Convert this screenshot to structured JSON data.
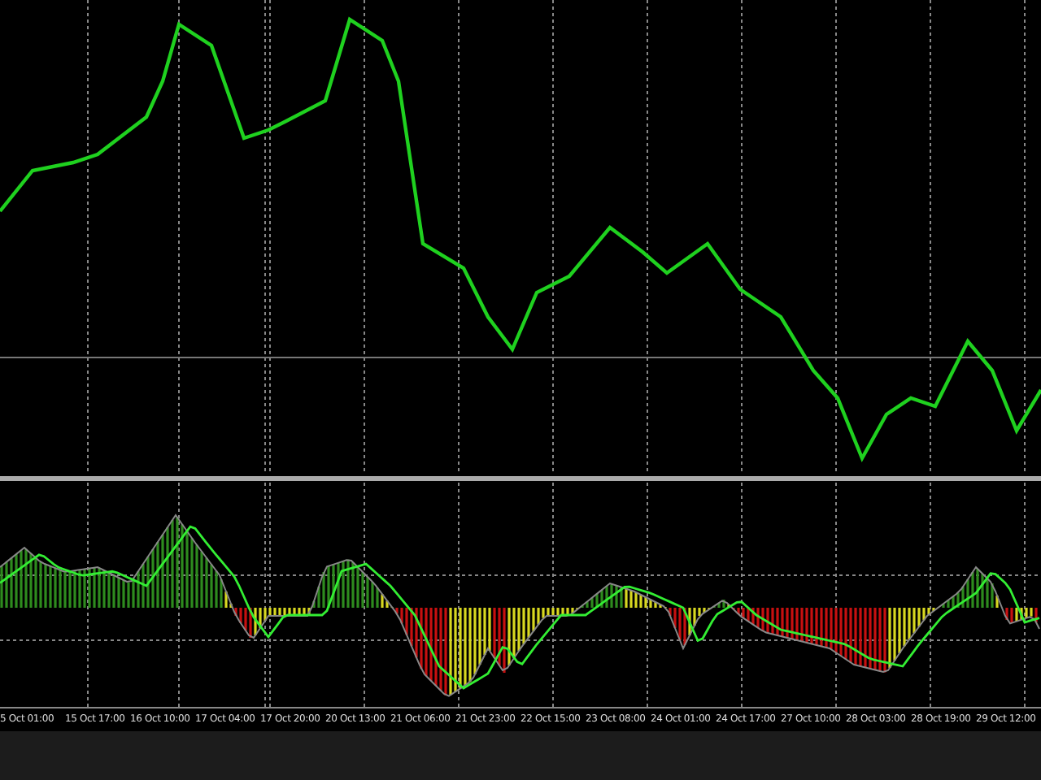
{
  "time_axis": {
    "labels": [
      "5 Oct 01:00",
      "15 Oct 17:00",
      "16 Oct 10:00",
      "17 Oct 04:00",
      "17 Oct 20:00",
      "20 Oct 13:00",
      "21 Oct 06:00",
      "21 Oct 23:00",
      "22 Oct 15:00",
      "23 Oct 08:00",
      "24 Oct 01:00",
      "24 Oct 17:00",
      "27 Oct 10:00",
      "28 Oct 03:00",
      "28 Oct 19:00",
      "29 Oct 12:00"
    ]
  }
}
